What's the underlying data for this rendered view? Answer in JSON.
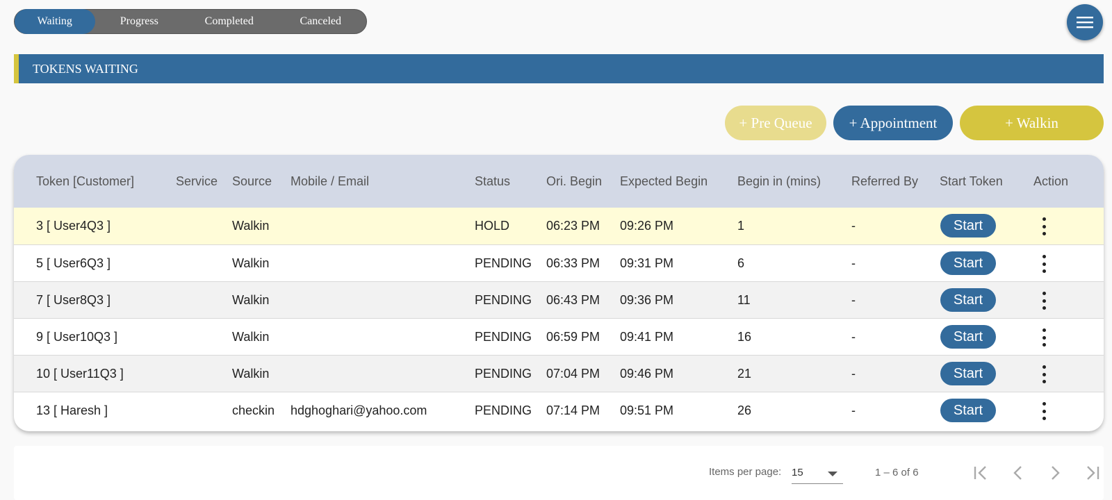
{
  "tabs": [
    {
      "label": "Waiting",
      "active": true
    },
    {
      "label": "Progress",
      "active": false
    },
    {
      "label": "Completed",
      "active": false
    },
    {
      "label": "Canceled",
      "active": false
    }
  ],
  "menu_icon": "hamburger-menu-icon",
  "section": {
    "title": "TOKENS WAITING"
  },
  "actions": {
    "prequeue": "+ Pre Queue",
    "appointment": "+ Appointment",
    "walkin": "+ Walkin"
  },
  "table": {
    "headers": [
      "Token [Customer]",
      "Service",
      "Source",
      "Mobile / Email",
      "Status",
      "Ori. Begin",
      "Expected Begin",
      "Begin in (mins)",
      "Referred By",
      "Start Token",
      "Action"
    ],
    "rows": [
      {
        "token": "3 [ User4Q3 ]",
        "service": "",
        "source": "Walkin",
        "contact": "",
        "status": "HOLD",
        "ori_begin": "06:23 PM",
        "expected_begin": "09:26 PM",
        "begin_in": "1",
        "referred_by": "-",
        "start": "Start",
        "highlight": true
      },
      {
        "token": "5 [ User6Q3 ]",
        "service": "",
        "source": "Walkin",
        "contact": "",
        "status": "PENDING",
        "ori_begin": "06:33 PM",
        "expected_begin": "09:31 PM",
        "begin_in": "6",
        "referred_by": "-",
        "start": "Start",
        "highlight": false
      },
      {
        "token": "7 [ User8Q3 ]",
        "service": "",
        "source": "Walkin",
        "contact": "",
        "status": "PENDING",
        "ori_begin": "06:43 PM",
        "expected_begin": "09:36 PM",
        "begin_in": "11",
        "referred_by": "-",
        "start": "Start",
        "highlight": false
      },
      {
        "token": "9 [ User10Q3 ]",
        "service": "",
        "source": "Walkin",
        "contact": "",
        "status": "PENDING",
        "ori_begin": "06:59 PM",
        "expected_begin": "09:41 PM",
        "begin_in": "16",
        "referred_by": "-",
        "start": "Start",
        "highlight": false
      },
      {
        "token": "10 [ User11Q3 ]",
        "service": "",
        "source": "Walkin",
        "contact": "",
        "status": "PENDING",
        "ori_begin": "07:04 PM",
        "expected_begin": "09:46 PM",
        "begin_in": "21",
        "referred_by": "-",
        "start": "Start",
        "highlight": false
      },
      {
        "token": "13 [ Haresh ]",
        "service": "",
        "source": "checkin",
        "contact": "hdghoghari@yahoo.com",
        "status": "PENDING",
        "ori_begin": "07:14 PM",
        "expected_begin": "09:51 PM",
        "begin_in": "26",
        "referred_by": "-",
        "start": "Start",
        "highlight": false
      }
    ]
  },
  "paginator": {
    "items_per_page_label": "Items per page:",
    "items_per_page": "15",
    "range": "1 – 6 of 6",
    "icons": [
      "first-page-icon",
      "previous-page-icon",
      "next-page-icon",
      "last-page-icon"
    ]
  },
  "colors": {
    "primary": "#336b9c",
    "accent": "#d5c53f",
    "accent_light": "#e8dc8e",
    "header_bg": "#d3d9e6",
    "highlight_row": "#fffcd8",
    "alt_row": "#f2f2f2"
  }
}
